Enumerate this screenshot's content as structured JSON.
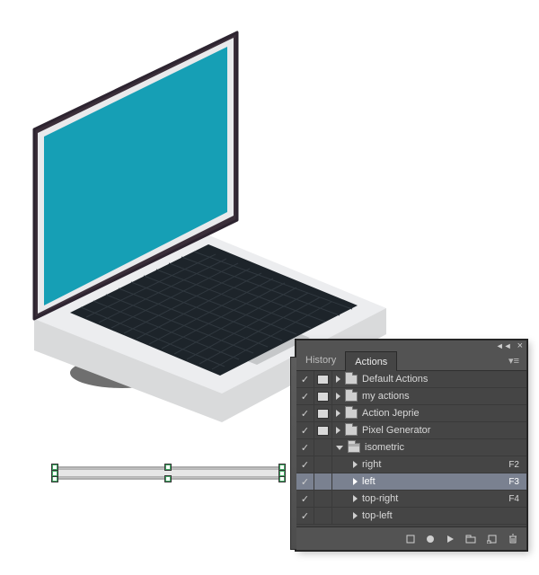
{
  "panel": {
    "tabs": {
      "history": "History",
      "actions": "Actions"
    },
    "sets": [
      {
        "label": "Default Actions",
        "checked": true,
        "mode": true
      },
      {
        "label": "my actions",
        "checked": true,
        "mode": true
      },
      {
        "label": "Action Jeprie",
        "checked": true,
        "mode": true
      },
      {
        "label": "Pixel Generator",
        "checked": true,
        "mode": true
      }
    ],
    "open_set": {
      "label": "isometric",
      "checked": true,
      "mode": false,
      "actions": [
        {
          "label": "right",
          "shortcut": "F2",
          "checked": true,
          "mode": false,
          "selected": false
        },
        {
          "label": "left",
          "shortcut": "F3",
          "checked": true,
          "mode": false,
          "selected": true
        },
        {
          "label": "top-right",
          "shortcut": "F4",
          "checked": true,
          "mode": false,
          "selected": false
        },
        {
          "label": "top-left",
          "shortcut": "",
          "checked": true,
          "mode": false,
          "selected": false
        }
      ]
    }
  }
}
